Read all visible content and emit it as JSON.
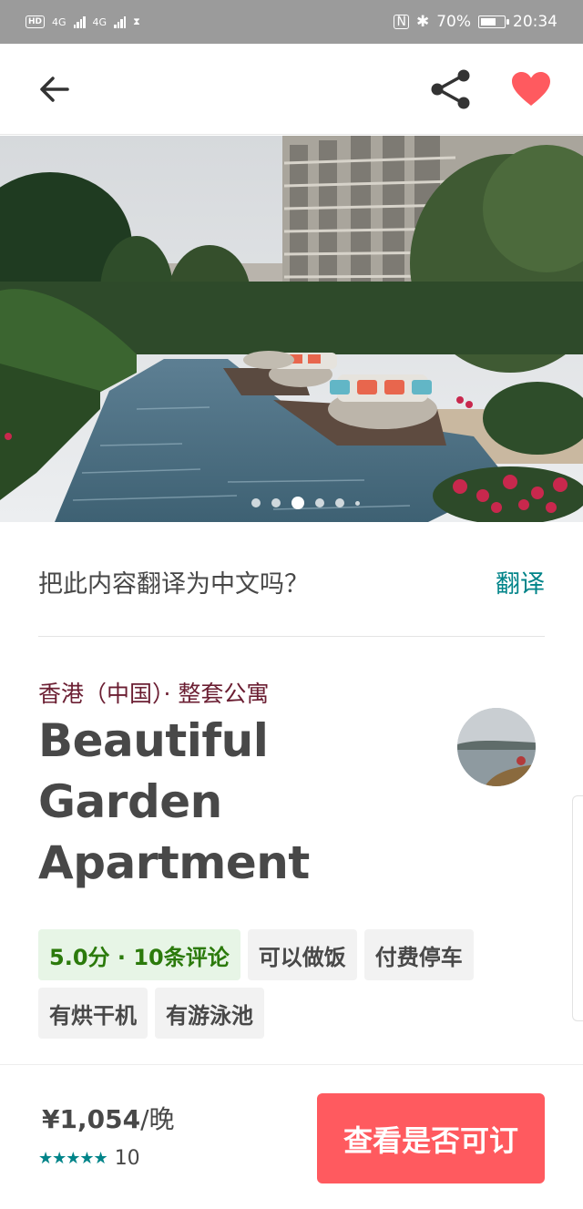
{
  "status_bar": {
    "hd_label": "HD",
    "network_1": "4G",
    "network_2": "4G",
    "battery_percent": "70%",
    "battery_level": 0.7,
    "time": "20:34"
  },
  "app_bar": {
    "back_icon": "arrow-left",
    "share_icon": "share",
    "favorite_icon": "heart-filled",
    "favorite_color": "#ff5a5f"
  },
  "gallery": {
    "photo_count": 6,
    "active_index": 2
  },
  "translate": {
    "prompt": "把此内容翻译为中文吗？",
    "action": "翻译"
  },
  "listing": {
    "location": "香港（中国）· 整套公寓",
    "title": "Beautiful Garden Apartment",
    "tags": [
      {
        "label": "5.0分 · 10条评论",
        "kind": "rating"
      },
      {
        "label": "可以做饭",
        "kind": "amenity"
      },
      {
        "label": "付费停车",
        "kind": "amenity"
      },
      {
        "label": "有烘干机",
        "kind": "amenity"
      },
      {
        "label": "有游泳池",
        "kind": "amenity"
      }
    ]
  },
  "booking": {
    "price": "¥1,054",
    "per_night": "/晚",
    "stars": "★★★★★",
    "review_count": "10",
    "button_label": "查看是否可订"
  },
  "colors": {
    "accent": "#ff5a5f",
    "teal": "#008489",
    "rating_green": "#2b7a0b",
    "location_maroon": "#6b1e32"
  }
}
